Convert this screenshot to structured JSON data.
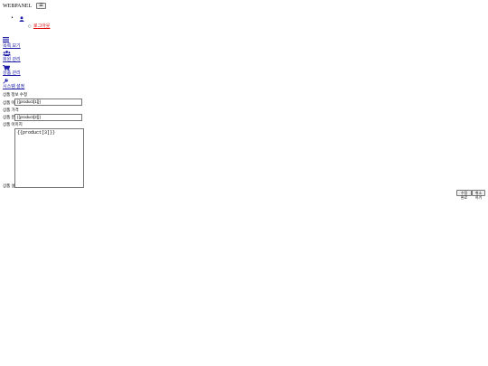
{
  "navbar": {
    "brand": "WEBPANEL",
    "toggle_symbol": "☰",
    "user_menu": {
      "icon": "user-icon",
      "logout_label": "로그아웃"
    }
  },
  "sidebar": {
    "items": [
      {
        "icon": "list-icon",
        "label": "목록 보기"
      },
      {
        "icon": "users-icon",
        "label": "회원 관리"
      },
      {
        "icon": "cart-icon",
        "label": "상품 관리"
      },
      {
        "icon": "wrench-icon",
        "label": "시스템 설정"
      }
    ]
  },
  "form": {
    "heading": "상품 정보 수정",
    "fields": [
      {
        "label": "상품 이름",
        "value": "{{product[1]}}"
      },
      {
        "label": "상품 가격",
        "value": ""
      },
      {
        "label": "상품 분류",
        "value": "{{product[2]}}"
      },
      {
        "label": "상품 이미지",
        "value": ""
      }
    ],
    "description": {
      "label": "상품 설명",
      "value": "{{product[3]}}"
    },
    "buttons": {
      "save_label": "수정 완료",
      "cancel_label": "취소하기"
    }
  },
  "colors": {
    "link": "#1a1aa6",
    "logout": "#e00000"
  }
}
